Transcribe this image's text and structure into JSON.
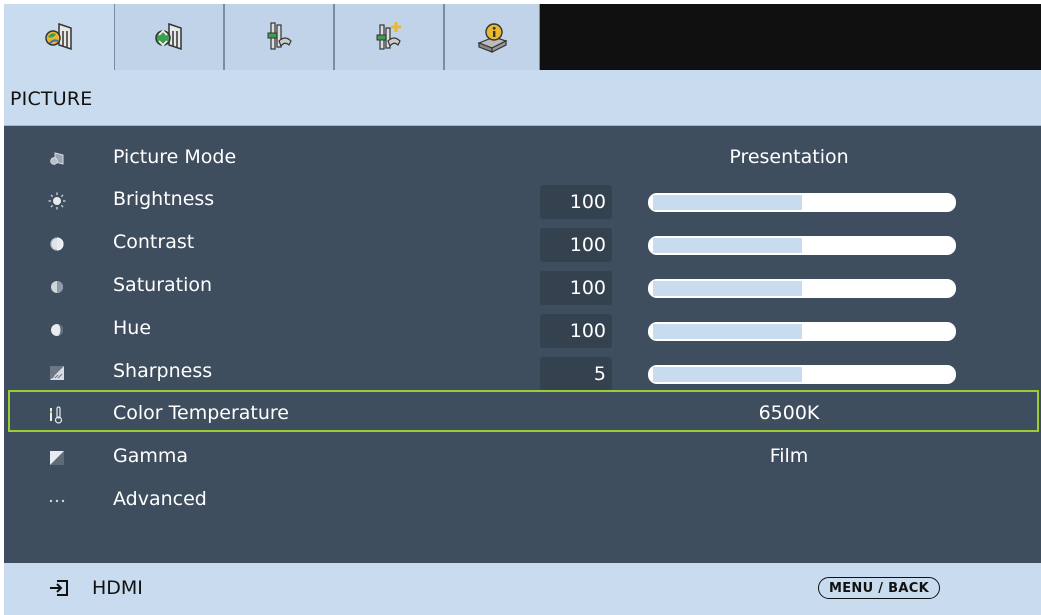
{
  "tabs": [
    {
      "icon": "picture-tab-icon"
    },
    {
      "icon": "display-tab-icon"
    },
    {
      "icon": "setup-tab-icon"
    },
    {
      "icon": "advanced-setup-tab-icon"
    },
    {
      "icon": "info-tab-icon"
    }
  ],
  "page_title": "PICTURE",
  "rows": [
    {
      "icon": "picture-mode-icon",
      "label": "Picture Mode",
      "value": "Presentation"
    },
    {
      "icon": "brightness-icon",
      "label": "Brightness",
      "number": "100",
      "level": 50
    },
    {
      "icon": "contrast-icon",
      "label": "Contrast",
      "number": "100",
      "level": 50
    },
    {
      "icon": "saturation-icon",
      "label": "Saturation",
      "number": "100",
      "level": 50
    },
    {
      "icon": "hue-icon",
      "label": "Hue",
      "number": "100",
      "level": 50
    },
    {
      "icon": "sharpness-icon",
      "label": "Sharpness",
      "number": "5",
      "level": 50
    },
    {
      "icon": "color-temperature-icon",
      "label": "Color Temperature",
      "value": "6500K",
      "selected": true
    },
    {
      "icon": "gamma-icon",
      "label": "Gamma",
      "value": "Film"
    },
    {
      "icon": "more-icon",
      "label": "Advanced"
    }
  ],
  "footer": {
    "source_icon": "input-source-icon",
    "source": "HDMI",
    "menu_back": "MENU / BACK"
  },
  "colors": {
    "panel": "#3f4e5e",
    "header": "#c9dcef",
    "selection": "#9acd32",
    "bar_fill": "#c9dcef"
  }
}
